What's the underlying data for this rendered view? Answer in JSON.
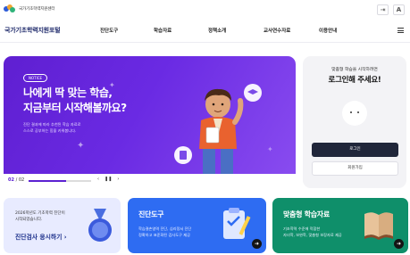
{
  "header": {
    "logo_text": "국가기초학력지원센터",
    "site_title": "국가기초학력지원포털",
    "nav": [
      "진단도구",
      "학습자료",
      "정책소개",
      "교사연수자료",
      "이용안내"
    ],
    "top_icons": [
      "login-icon",
      "text-size-icon"
    ]
  },
  "hero": {
    "badge": "NOTICE",
    "title": "나에게 딱 맞는 학습,\n지금부터 시작해볼까요?",
    "desc": "진단 결과에 따라 추천된 학습 자료로\n스스로 공부하는 힘을 키워봅니다.",
    "pager_current": "02",
    "pager_total": "/ 02",
    "progress": 0.6
  },
  "login": {
    "subtitle": "맞춤형 학습을 시작하려면",
    "title": "로그인해 주세요!",
    "login_button": "로그인",
    "join_button": "회원가입"
  },
  "cards": {
    "card1": {
      "text": "2026학년도 기초학력 진단이\n시작되었습니다.",
      "link": "진단검사 응시하기 ›"
    },
    "card2": {
      "title": "진단도구",
      "desc": "학습결손영역 진단, 심리정서 진단\n정확하고 표준화된 검사도구 제공"
    },
    "card3": {
      "title": "맞춤형 학습자료",
      "desc": "기초학력 수준에 적합한\n자녀학, 보완학, 맞춤형 보장자료 제공"
    }
  },
  "colors": {
    "brand_navy": "#1f2a6b",
    "hero_purple": "#6a2ae3",
    "card_blue": "#2e6cf2",
    "card_green": "#0f8f6a"
  }
}
